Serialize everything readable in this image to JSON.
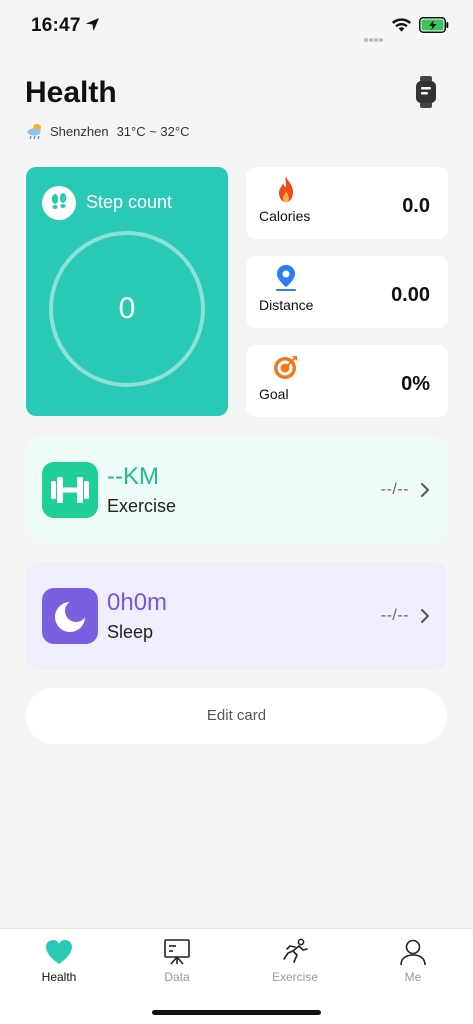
{
  "status_bar": {
    "time": "16:47"
  },
  "header": {
    "title": "Health",
    "weather_city": "Shenzhen",
    "weather_temp": "31°C ~ 32°C"
  },
  "step_card": {
    "label": "Step count",
    "value": "0"
  },
  "metrics": [
    {
      "label": "Calories",
      "value": "0.0",
      "icon": "flame-icon",
      "color": "#f04a1a"
    },
    {
      "label": "Distance",
      "value": "0.00",
      "icon": "location-pin-icon",
      "color": "#2f7cf6"
    },
    {
      "label": "Goal",
      "value": "0%",
      "icon": "target-icon",
      "color": "#f07a1a"
    }
  ],
  "exercise_card": {
    "value": "--KM",
    "label": "Exercise",
    "date": "--/--"
  },
  "sleep_card": {
    "value": "0h0m",
    "label": "Sleep",
    "date": "--/--"
  },
  "edit_card": {
    "label": "Edit card"
  },
  "tab_bar": {
    "items": [
      {
        "label": "Health",
        "icon": "heart-icon",
        "active": true
      },
      {
        "label": "Data",
        "icon": "chart-board-icon",
        "active": false
      },
      {
        "label": "Exercise",
        "icon": "runner-icon",
        "active": false
      },
      {
        "label": "Me",
        "icon": "person-icon",
        "active": false
      }
    ]
  },
  "colors": {
    "accent_teal": "#2ac9b6",
    "exercise_green": "#1fcf9a",
    "sleep_purple": "#7a60e0",
    "battery_green": "#34c759"
  }
}
